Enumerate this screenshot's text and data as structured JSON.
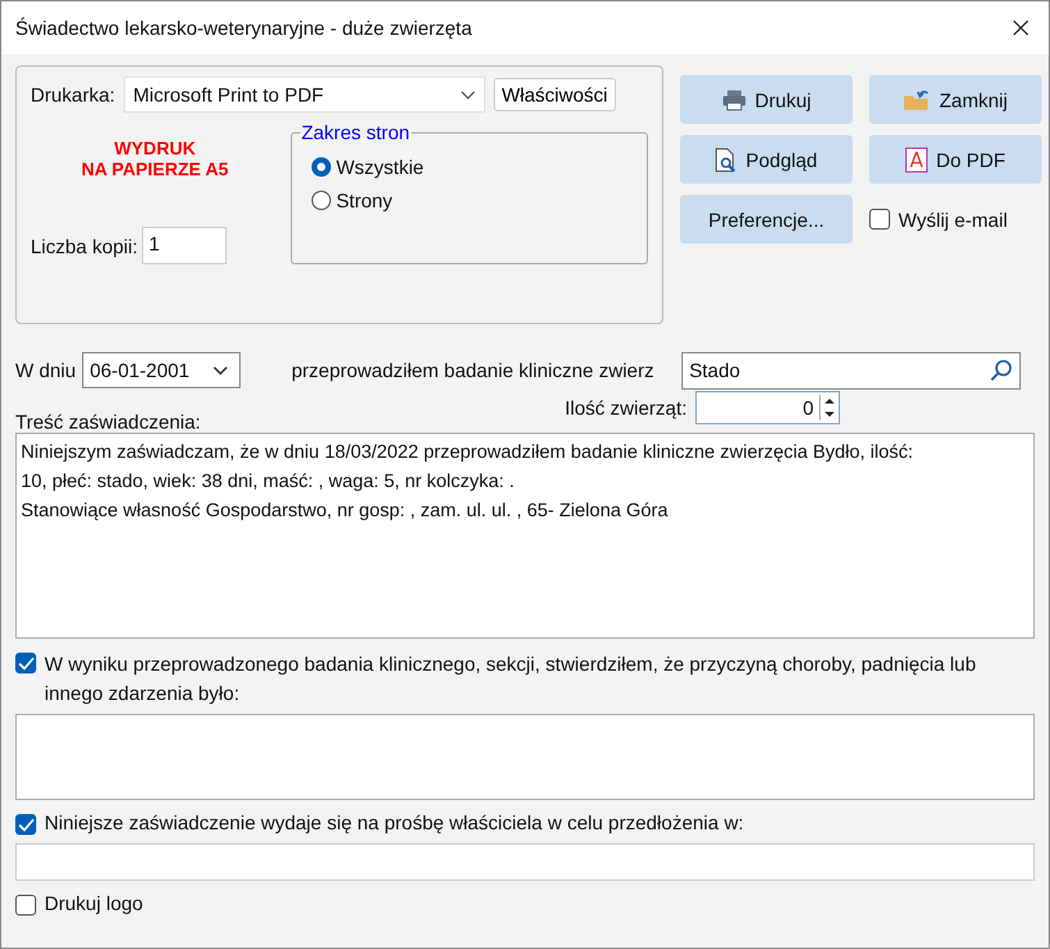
{
  "window": {
    "title": "Świadectwo lekarsko-weterynaryjne - duże zwierzęta"
  },
  "printer": {
    "label": "Drukarka:",
    "value": "Microsoft Print to PDF",
    "properties_button": "Właściwości"
  },
  "notice": [
    "WYDRUK",
    "NA PAPIERZE A5"
  ],
  "copies": {
    "label": "Liczba kopii:",
    "value": "1"
  },
  "page_range": {
    "title": "Zakres stron",
    "options": [
      {
        "label": "Wszystkie",
        "selected": true
      },
      {
        "label": "Strony",
        "selected": false
      }
    ]
  },
  "buttons": [
    {
      "label": "Drukuj",
      "kind": "print"
    },
    {
      "label": "Zamknij",
      "kind": "close"
    },
    {
      "label": "Podgląd",
      "kind": "preview"
    },
    {
      "label": "Do PDF",
      "kind": "pdf"
    },
    {
      "label": "Preferencje...",
      "kind": "plain"
    }
  ],
  "send_email": {
    "label": "Wyślij e-mail",
    "checked": false
  },
  "date": {
    "label": "W dniu",
    "value": "06-01-2001"
  },
  "exam": {
    "label": "przeprowadziłem badanie kliniczne zwierz",
    "value": "Stado"
  },
  "count": {
    "label": "Ilość zwierząt:",
    "value": "0"
  },
  "content": {
    "label": "Treść zaświadczenia:",
    "lines": [
      "Niniejszym zaświadczam, że w dniu 18/03/2022 przeprowadziłem badanie kliniczne zwierzęcia Bydło, ilość:",
      "10, płeć: stado, wiek: 38 dni, maść: , waga: 5, nr kolczyka: .",
      "Stanowiące własność Gospodarstwo, nr gosp: , zam. ul. ul. , 65- Zielona Góra"
    ]
  },
  "findings": {
    "checked": true,
    "label": "W wyniku przeprowadzonego badania klinicznego, sekcji, stwierdziłem, że przyczyną choroby, padnięcia lub innego zdarzenia było:"
  },
  "purpose": {
    "checked": true,
    "label": "Niniejsze zaświadczenie wydaje się na prośbę właściciela w celu przedłożenia w:"
  },
  "print_logo": {
    "checked": false,
    "label": "Drukuj logo"
  }
}
